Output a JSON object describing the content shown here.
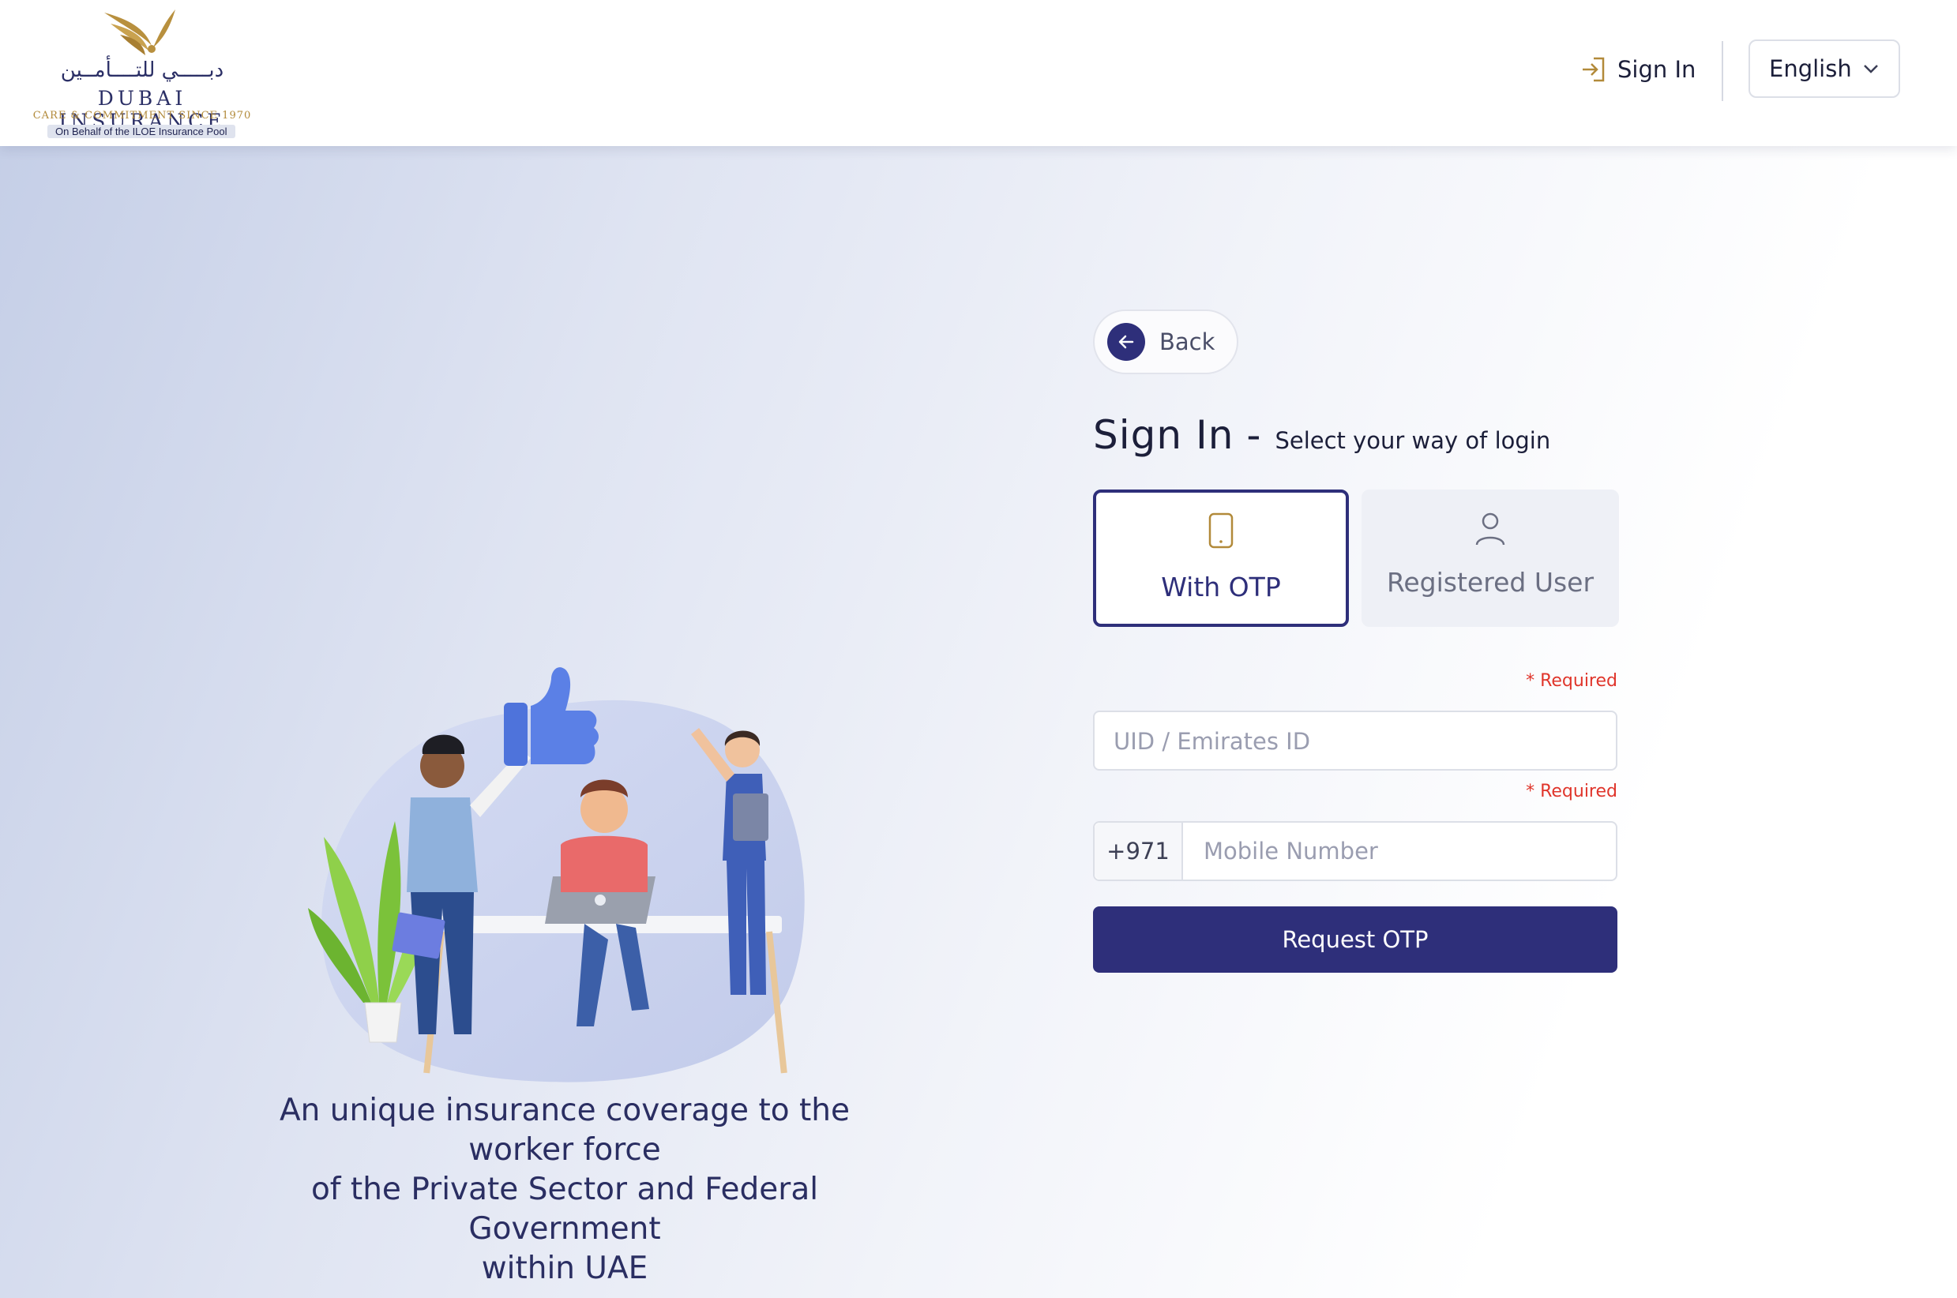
{
  "header": {
    "logo": {
      "arabic_text": "دبـــــي للتــــأمــين",
      "brand_text": "DUBAI INSURANCE",
      "tagline": "CARE & COMMITMENT SINCE 1970",
      "pool_text": "On Behalf of the ILOE Insurance Pool"
    },
    "signin_label": "Sign In",
    "language_label": "English"
  },
  "illustration": {
    "caption_lines": [
      "An unique insurance coverage to the",
      "worker force",
      "of the Private Sector and Federal",
      "Government",
      "within UAE"
    ]
  },
  "form": {
    "back_label": "Back",
    "title": "Sign In",
    "dash": "-",
    "subtitle": "Select your way of login",
    "options": [
      {
        "label": "With OTP",
        "icon": "phone-icon",
        "selected": true
      },
      {
        "label": "Registered User",
        "icon": "user-icon",
        "selected": false
      }
    ],
    "required_label": "* Required",
    "uid_placeholder": "UID / Emirates ID",
    "phone_prefix": "+971",
    "mobile_placeholder": "Mobile Number",
    "submit_label": "Request OTP"
  },
  "colors": {
    "primary": "#2e2f7a",
    "accent_gold": "#b28a3a",
    "required_red": "#e0352b"
  }
}
